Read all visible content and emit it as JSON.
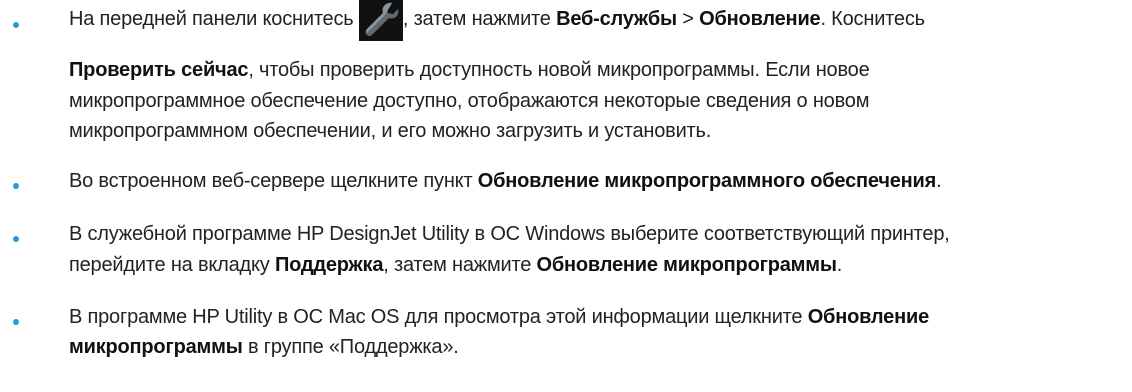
{
  "bullet_color": "#1ea0dc",
  "items": [
    {
      "line1_before_icon": "На передней панели коснитесь ",
      "icon": "wrench-icon",
      "line1_after_icon": ", затем нажмите ",
      "line1_bold1": "Веб-службы",
      "line1_sep": " > ",
      "line1_bold2": "Обновление",
      "line1_end": ". Коснитесь",
      "line2_bold": "Проверить сейчас",
      "line2_rest": ", чтобы проверить доступность новой микропрограммы. Если новое",
      "line3": "микропрограммное обеспечение доступно, отображаются некоторые сведения о новом",
      "line4": "микропрограммном обеспечении, и его можно загрузить и установить."
    },
    {
      "text_before": "Во встроенном веб-сервере щелкните пункт ",
      "bold": "Обновление микропрограммного обеспечения",
      "text_after": "."
    },
    {
      "line1": "В служебной программе HP DesignJet Utility в ОС Windows выберите соответствующий принтер,",
      "line2_before": "перейдите на вкладку ",
      "line2_bold1": "Поддержка",
      "line2_mid": ", затем нажмите ",
      "line2_bold2": "Обновление микропрограммы",
      "line2_end": "."
    },
    {
      "line1_before": "В программе HP Utility в ОС Mac OS для просмотра этой информации щелкните ",
      "line1_bold": "Обновление",
      "line2_bold": "микропрограммы",
      "line2_rest": " в группе «Поддержка»."
    }
  ]
}
